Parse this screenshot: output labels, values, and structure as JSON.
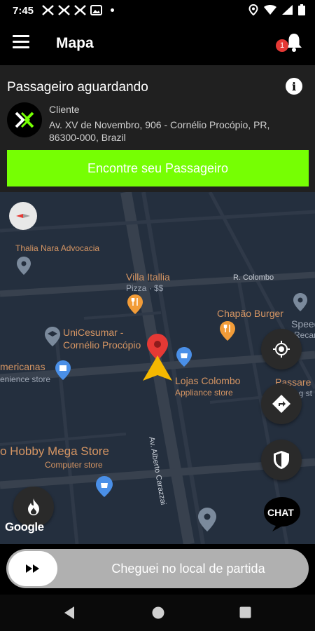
{
  "status_bar": {
    "time": "7:45"
  },
  "app_bar": {
    "title": "Mapa",
    "notification_count": "1"
  },
  "card": {
    "heading": "Passageiro aguardando",
    "client_label": "Cliente",
    "address": "Av. XV de Novembro, 906 - Cornélio Procópio, PR, 86300-000, Brazil",
    "cta_label": "Encontre seu Passageiro",
    "cta_color": "#76ff03"
  },
  "map": {
    "places": {
      "thalia": "Thalia Nara Advocacia",
      "villa_italia": "Villa Itallia",
      "villa_italia_sub": "Pizza · $$",
      "r_colombo": "R. Colombo",
      "chapao": "Chapão Burger",
      "speed": "Speed",
      "speed_sub": "Recar",
      "unicesumar_1": "UniCesumar -",
      "unicesumar_2": "Cornélio Procópio",
      "americanas": "mericanas",
      "americanas_sub": "enience store",
      "lojas_colombo": "Lojas Colombo",
      "lojas_colombo_sub": "Appliance store",
      "passare": "Passare",
      "passare_sub": "ng st",
      "hobby": "o Hobby Mega Store",
      "hobby_sub": "Computer store",
      "street": "Av. Alberto Carazzai"
    },
    "google_logo": "Google",
    "chat_label": "CHAT"
  },
  "slider": {
    "label": "Cheguei no local de partida"
  },
  "colors": {
    "map_bg": "#242f3e",
    "poi_orange": "#f29c38",
    "poi_blue": "#4a8fe7",
    "pin_red": "#e53935",
    "nav_arrow": "#f5b800"
  }
}
